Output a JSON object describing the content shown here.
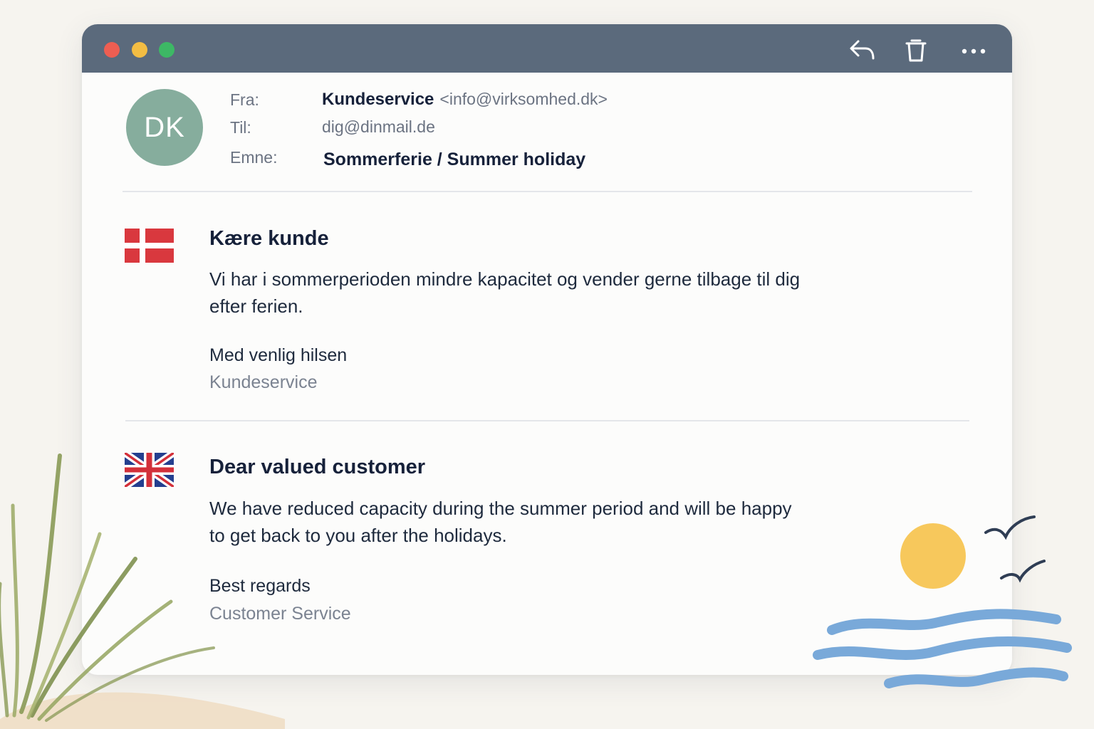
{
  "window": {
    "toolbar": {
      "traffic_lights": [
        "close",
        "minimize",
        "maximize"
      ],
      "icons": {
        "reply": "reply-arrow-icon",
        "delete": "trash-icon",
        "more": "more-horizontal-icon"
      }
    }
  },
  "header": {
    "avatar_initials": "DK",
    "from_label": "Fra:",
    "from_name": "Kundeservice",
    "from_email": "<info@virksomhed.dk>",
    "to_label": "Til:",
    "to_email": "dig@dinmail.de",
    "subject_label": "Emne:",
    "subject": "Sommerferie / Summer holiday"
  },
  "body": {
    "danish": {
      "flag": "denmark-flag-icon",
      "greeting": "Kære kunde",
      "paragraph": "Vi har i sommerperioden mindre kapacitet og vender gerne tilbage til dig efter ferien.",
      "closing": "Med venlig hilsen",
      "signature": "Kundeservice"
    },
    "english": {
      "flag": "uk-flag-icon",
      "greeting": "Dear valued customer",
      "paragraph": "We have reduced capacity during the summer period and will be happy to get back to you after the holidays.",
      "closing": "Best regards",
      "signature": "Customer Service"
    }
  },
  "colors": {
    "titlebar": "#5b6a7c",
    "avatar": "#86ad9d",
    "close_light": "#ee5e52",
    "minimize_light": "#f3bd43",
    "maximize_light": "#3db865",
    "sun": "#f7c85c",
    "waves": "#79a9d9",
    "grass": "#8a9a55"
  },
  "decorations": [
    "grass-illustration",
    "sun-illustration",
    "birds-illustration",
    "waves-illustration"
  ]
}
